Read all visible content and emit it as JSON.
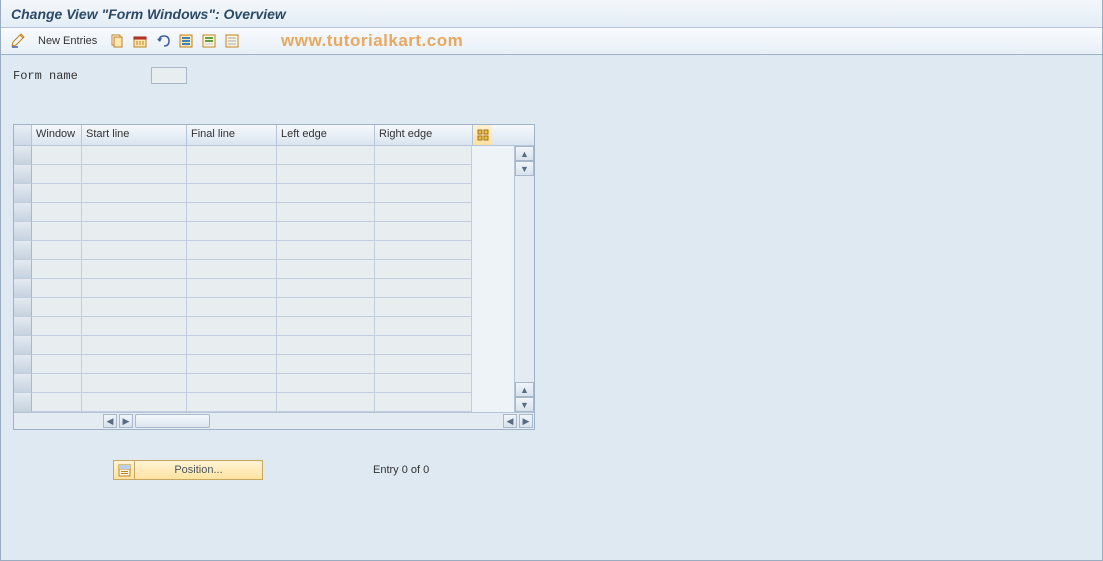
{
  "title": "Change View \"Form Windows\": Overview",
  "toolbar": {
    "new_entries": "New Entries"
  },
  "watermark": "www.tutorialkart.com",
  "form": {
    "name_label": "Form name",
    "name_value": ""
  },
  "table": {
    "columns": {
      "window": "Window",
      "start_line": "Start line",
      "final_line": "Final line",
      "left_edge": "Left edge",
      "right_edge": "Right edge"
    },
    "row_count": 14
  },
  "footer": {
    "position_label": "Position...",
    "entry_text": "Entry 0 of 0"
  }
}
